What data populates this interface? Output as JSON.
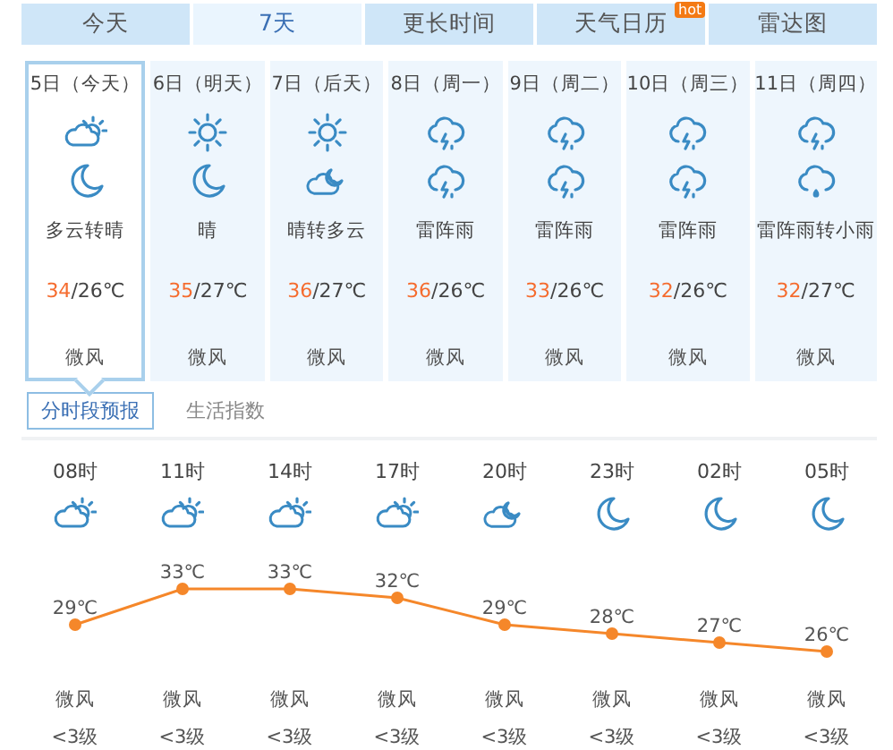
{
  "tabs": [
    {
      "label": "今天",
      "selected": false
    },
    {
      "label": "7天",
      "selected": true
    },
    {
      "label": "更长时间",
      "selected": false
    },
    {
      "label": "天气日历",
      "selected": false,
      "badge": "hot"
    },
    {
      "label": "雷达图",
      "selected": false
    }
  ],
  "days": [
    {
      "date": "5日（今天）",
      "icons": [
        {
          "kind": "partly_cloudy"
        },
        {
          "kind": "moon"
        }
      ],
      "weather": "多云转晴",
      "high": "34",
      "rest": "/26℃",
      "wind": "微风",
      "selected": true
    },
    {
      "date": "6日（明天）",
      "icons": [
        {
          "kind": "sunny"
        },
        {
          "kind": "moon"
        }
      ],
      "weather": "晴",
      "high": "35",
      "rest": "/27℃",
      "wind": "微风",
      "selected": false
    },
    {
      "date": "7日（后天）",
      "icons": [
        {
          "kind": "sunny"
        },
        {
          "kind": "cloud_moon"
        }
      ],
      "weather": "晴转多云",
      "high": "36",
      "rest": "/27℃",
      "wind": "微风",
      "selected": false
    },
    {
      "date": "8日（周一）",
      "icons": [
        {
          "kind": "thunder_rain"
        },
        {
          "kind": "thunder_rain"
        }
      ],
      "weather": "雷阵雨",
      "high": "36",
      "rest": "/26℃",
      "wind": "微风",
      "selected": false
    },
    {
      "date": "9日（周二）",
      "icons": [
        {
          "kind": "thunder_rain"
        },
        {
          "kind": "thunder_rain"
        }
      ],
      "weather": "雷阵雨",
      "high": "33",
      "rest": "/26℃",
      "wind": "微风",
      "selected": false
    },
    {
      "date": "10日（周三）",
      "icons": [
        {
          "kind": "thunder_rain"
        },
        {
          "kind": "thunder_rain"
        }
      ],
      "weather": "雷阵雨",
      "high": "32",
      "rest": "/26℃",
      "wind": "微风",
      "selected": false
    },
    {
      "date": "11日（周四）",
      "icons": [
        {
          "kind": "thunder_rain"
        },
        {
          "kind": "light_rain"
        }
      ],
      "weather": "雷阵雨转小雨",
      "high": "32",
      "rest": "/27℃",
      "wind": "微风",
      "selected": false
    }
  ],
  "subtabs": [
    {
      "label": "分时段预报",
      "selected": true
    },
    {
      "label": "生活指数",
      "selected": false
    }
  ],
  "hourly": {
    "icons": [
      {
        "kind": "partly_cloudy"
      },
      {
        "kind": "partly_cloudy"
      },
      {
        "kind": "partly_cloudy"
      },
      {
        "kind": "partly_cloudy"
      },
      {
        "kind": "cloud_moon"
      },
      {
        "kind": "moon"
      },
      {
        "kind": "moon"
      },
      {
        "kind": "moon"
      }
    ],
    "winds": [
      {
        "wind": "微风",
        "force": "<3级"
      },
      {
        "wind": "微风",
        "force": "<3级"
      },
      {
        "wind": "微风",
        "force": "<3级"
      },
      {
        "wind": "微风",
        "force": "<3级"
      },
      {
        "wind": "微风",
        "force": "<3级"
      },
      {
        "wind": "微风",
        "force": "<3级"
      },
      {
        "wind": "微风",
        "force": "<3级"
      },
      {
        "wind": "微风",
        "force": "<3级"
      }
    ],
    "chart_data": {
      "type": "line",
      "categories": [
        "08时",
        "11时",
        "14时",
        "17时",
        "20时",
        "23时",
        "02时",
        "05时"
      ],
      "series": [
        {
          "color": "#f5872a",
          "marker": "circle",
          "values": [
            29,
            33,
            33,
            32,
            29,
            28,
            27,
            26
          ],
          "value_labels": [
            "29℃",
            "33℃",
            "33℃",
            "32℃",
            "29℃",
            "28℃",
            "27℃",
            "26℃"
          ]
        }
      ]
    }
  }
}
